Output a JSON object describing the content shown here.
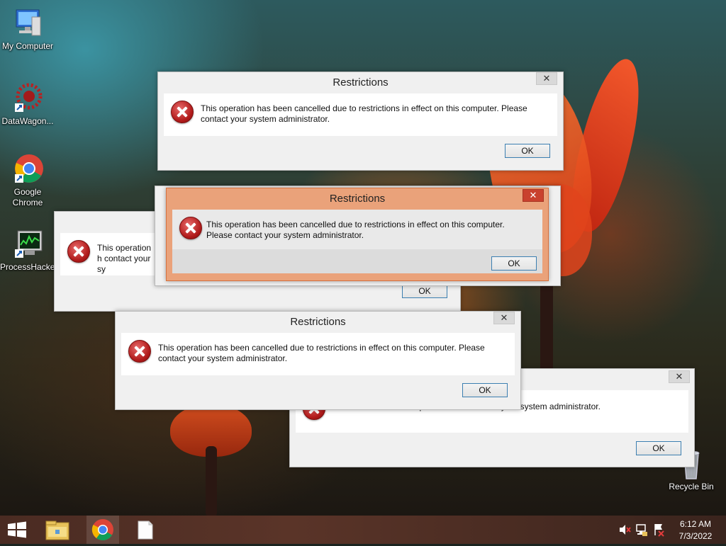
{
  "desktop": {
    "icons": [
      {
        "label": "My Computer",
        "icon": "computer-icon"
      },
      {
        "label": "DataWagon...",
        "icon": "datawagon-icon"
      },
      {
        "label": "Google Chrome",
        "icon": "chrome-icon"
      },
      {
        "label": "ProcessHacker",
        "icon": "processhacker-icon"
      },
      {
        "label": "Recycle Bin",
        "icon": "recycle-bin-icon"
      }
    ]
  },
  "dialogs": [
    {
      "title": "Restrictions",
      "message": "This operation has been cancelled due to restrictions in effect on this computer. Please contact your system administrator.",
      "ok_label": "OK",
      "close_label": "✕"
    },
    {
      "title": "Restrictions",
      "message": "This operation has been cancelled due to restrictions in effect on this computer. Please contact your system administrator.",
      "ok_label": "OK",
      "close_label": "✕"
    },
    {
      "title": "",
      "message": "This operation h contact your sy",
      "ok_label": "OK",
      "close_label": ""
    },
    {
      "title": "Restrictions",
      "message": "This operation has been cancelled due to restrictions in effect on this computer. Please contact your system administrator.",
      "ok_label": "OK",
      "close_label": "✕"
    },
    {
      "title": "",
      "message": "ns in effect on this computer. Please contact your system administrator.",
      "ok_label": "OK",
      "close_label": "✕"
    }
  ],
  "taskbar": {
    "time": "6:12 AM",
    "date": "7/3/2022",
    "items": [
      "start-icon",
      "file-explorer-icon",
      "chrome-icon",
      "document-icon"
    ],
    "tray": [
      "volume-muted-icon",
      "network-icon",
      "action-center-icon"
    ]
  },
  "colors": {
    "active_dialog": "#eaa27a",
    "ok_border": "#3c7fb1",
    "error_red": "#b01a1a"
  }
}
